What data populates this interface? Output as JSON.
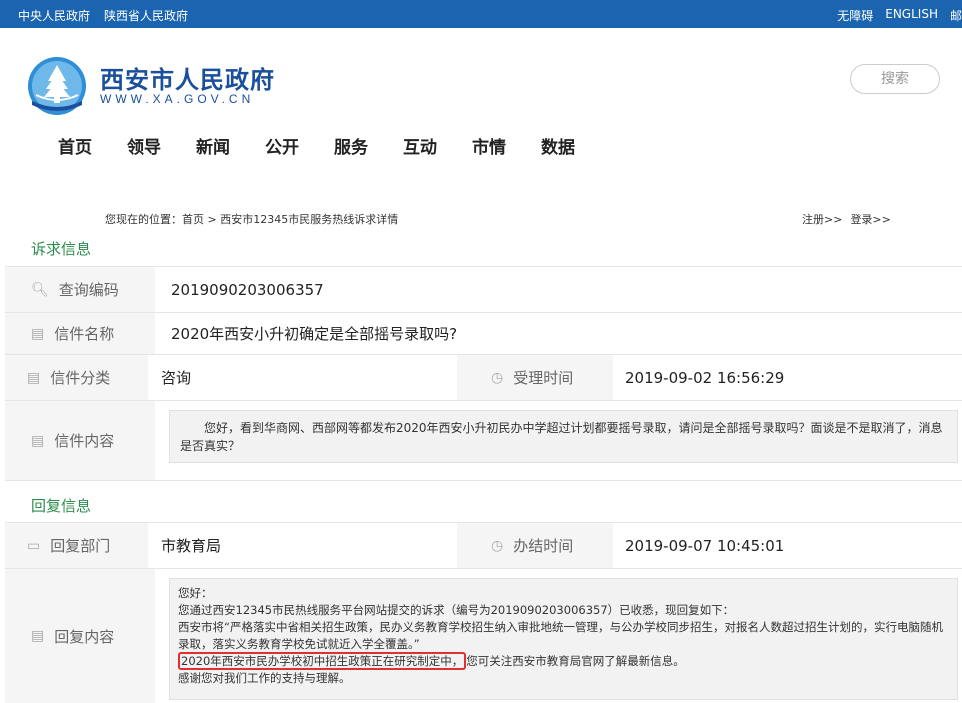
{
  "topbar": {
    "links_left": [
      "中央人民政府",
      "陕西省人民政府"
    ],
    "links_right": [
      "无障碍",
      "ENGLISH",
      "邮"
    ]
  },
  "header": {
    "site_name": "西安市人民政府",
    "site_domain": "WWW.XA.GOV.CN",
    "search_placeholder": "搜索"
  },
  "nav": [
    "首页",
    "领导",
    "新闻",
    "公开",
    "服务",
    "互动",
    "市情",
    "数据"
  ],
  "breadcrumb": {
    "text": "您现在的位置：首页 > 西安市12345市民服务热线诉求详情",
    "register": "注册>>",
    "login": "登录>>"
  },
  "appeal": {
    "section_title": "诉求信息",
    "query_code_label": "查询编码",
    "query_code": "2019090203006357",
    "letter_name_label": "信件名称",
    "letter_name": "2020年西安小升初确定是全部摇号录取吗?",
    "category_label": "信件分类",
    "category": "咨询",
    "accept_time_label": "受理时间",
    "accept_time": "2019-09-02 16:56:29",
    "content_label": "信件内容",
    "content": "您好，看到华商网、西部网等都发布2020年西安小升初民办中学超过计划都要摇号录取，请问是全部摇号录取吗？面谈是不是取消了，消息是否真实？"
  },
  "reply": {
    "section_title": "回复信息",
    "dept_label": "回复部门",
    "dept": "市教育局",
    "done_time_label": "办结时间",
    "done_time": "2019-09-07 10:45:01",
    "content_label": "回复内容",
    "line1": "您好：",
    "line2": "您通过西安12345市民热线服务平台网站提交的诉求（编号为2019090203006357）已收悉，现回复如下：",
    "line3": "西安市将“严格落实中省相关招生政策，民办义务教育学校招生纳入审批地统一管理，与公办学校同步招生，对报名人数超过招生计划的，实行电脑随机录取，落实义务教育学校免试就近入学全覆盖。”",
    "line4_highlight": "2020年西安市民办学校初中招生政策正在研究制定中，",
    "line4_rest": "您可关注西安市教育局官网了解最新信息。",
    "line5": "感谢您对我们工作的支持与理解。"
  }
}
